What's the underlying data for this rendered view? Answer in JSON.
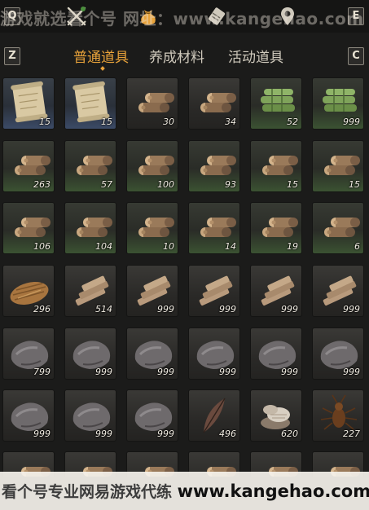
{
  "header": {
    "key_left": "Q",
    "key_right": "E",
    "icons": [
      "crossed-swords-icon",
      "pouch-icon",
      "scroll-icon",
      "map-pin-icon"
    ],
    "watermark": "游戏就选看个号  网址：www.kangehao.com"
  },
  "tabs": {
    "key_left": "Z",
    "key_right": "C",
    "items": [
      {
        "label": "普通道具",
        "active": true
      },
      {
        "label": "养成材料",
        "active": false
      },
      {
        "label": "活动道具",
        "active": false
      }
    ]
  },
  "inventory": {
    "items": [
      {
        "icon": "scroll-icon",
        "qty": "15",
        "tier": "blue"
      },
      {
        "icon": "scroll-icon",
        "qty": "15",
        "tier": "blue"
      },
      {
        "icon": "logs-icon",
        "qty": "30",
        "tier": "normal"
      },
      {
        "icon": "logs-icon",
        "qty": "34",
        "tier": "normal"
      },
      {
        "icon": "bamboo-icon",
        "qty": "52",
        "tier": "green"
      },
      {
        "icon": "bamboo-icon",
        "qty": "999",
        "tier": "green"
      },
      {
        "icon": "logs-icon",
        "qty": "263",
        "tier": "green"
      },
      {
        "icon": "logs-icon",
        "qty": "57",
        "tier": "green"
      },
      {
        "icon": "logs-icon",
        "qty": "100",
        "tier": "green"
      },
      {
        "icon": "logs-icon",
        "qty": "93",
        "tier": "green"
      },
      {
        "icon": "logs-icon",
        "qty": "15",
        "tier": "green"
      },
      {
        "icon": "logs-icon",
        "qty": "15",
        "tier": "green"
      },
      {
        "icon": "logs-icon",
        "qty": "106",
        "tier": "green"
      },
      {
        "icon": "logs-icon",
        "qty": "104",
        "tier": "green"
      },
      {
        "icon": "logs-icon",
        "qty": "10",
        "tier": "green"
      },
      {
        "icon": "logs-icon",
        "qty": "14",
        "tier": "green"
      },
      {
        "icon": "logs-icon",
        "qty": "19",
        "tier": "green"
      },
      {
        "icon": "logs-icon",
        "qty": "6",
        "tier": "green"
      },
      {
        "icon": "straw-bundle-icon",
        "qty": "296",
        "tier": "normal"
      },
      {
        "icon": "planks-icon",
        "qty": "514",
        "tier": "normal"
      },
      {
        "icon": "planks-icon",
        "qty": "999",
        "tier": "normal"
      },
      {
        "icon": "planks-icon",
        "qty": "999",
        "tier": "normal"
      },
      {
        "icon": "planks-icon",
        "qty": "999",
        "tier": "normal"
      },
      {
        "icon": "planks-icon",
        "qty": "999",
        "tier": "normal"
      },
      {
        "icon": "stone-icon",
        "qty": "799",
        "tier": "normal"
      },
      {
        "icon": "stone-icon",
        "qty": "999",
        "tier": "normal"
      },
      {
        "icon": "stone-icon",
        "qty": "999",
        "tier": "normal"
      },
      {
        "icon": "stone-icon",
        "qty": "999",
        "tier": "normal"
      },
      {
        "icon": "stone-icon",
        "qty": "999",
        "tier": "normal"
      },
      {
        "icon": "stone-icon",
        "qty": "999",
        "tier": "normal"
      },
      {
        "icon": "stone-icon",
        "qty": "999",
        "tier": "normal"
      },
      {
        "icon": "stone-icon",
        "qty": "999",
        "tier": "normal"
      },
      {
        "icon": "stone-icon",
        "qty": "999",
        "tier": "normal"
      },
      {
        "icon": "feather-icon",
        "qty": "496",
        "tier": "normal"
      },
      {
        "icon": "shell-icon",
        "qty": "620",
        "tier": "normal"
      },
      {
        "icon": "insect-icon",
        "qty": "227",
        "tier": "normal"
      },
      {
        "icon": "logs-icon",
        "qty": "",
        "tier": "normal"
      },
      {
        "icon": "logs-icon",
        "qty": "",
        "tier": "normal"
      },
      {
        "icon": "logs-icon",
        "qty": "",
        "tier": "normal"
      },
      {
        "icon": "logs-icon",
        "qty": "",
        "tier": "normal"
      },
      {
        "icon": "logs-icon",
        "qty": "",
        "tier": "normal"
      },
      {
        "icon": "logs-icon",
        "qty": "",
        "tier": "normal"
      }
    ]
  },
  "footer": {
    "watermark_prefix": "看个号专业网易游戏代练",
    "watermark_url": "www.kangehao.com"
  },
  "colors": {
    "accent": "#e8a23a",
    "background": "#1b1b1a"
  }
}
